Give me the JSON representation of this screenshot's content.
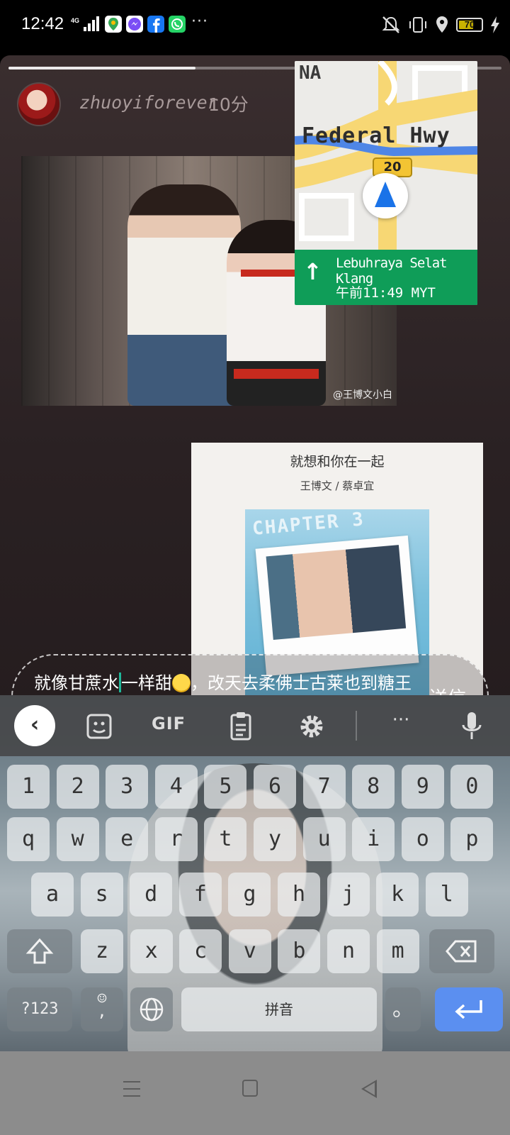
{
  "status_bar": {
    "time": "12:42",
    "network": "4G",
    "more": "···",
    "battery": "70",
    "battery_level": 0.7,
    "app_icons": [
      {
        "name": "maps-icon",
        "color": "#ffffff"
      },
      {
        "name": "messenger-icon",
        "color": "#2f6cf6"
      },
      {
        "name": "facebook-icon",
        "color": "#1877f2"
      },
      {
        "name": "whatsapp-icon",
        "color": "#25d366"
      }
    ]
  },
  "story": {
    "username": "zhuoyiforever",
    "time_ago": "10分",
    "progress": 0.38,
    "photo_watermark": "@王博文小白"
  },
  "map": {
    "area_label": "NA",
    "road_label": "Federal Hwy",
    "route_shield": "20",
    "next_street": "Lebuhraya Selat Klang",
    "eta": "午前11:49 MYT",
    "banner_color": "#0f9d58"
  },
  "song": {
    "title": "就想和你在一起",
    "artist": "王博文 / 蔡卓宜",
    "cover_text": "CHAPTER 3"
  },
  "reply": {
    "text_before_caret": "就像甘蔗水",
    "text_after_caret": "一样甜",
    "text_middle": "，改天去柔佛士古莱也到糖王那儿走走逛逛",
    "send_label": "送信"
  },
  "keyboard": {
    "toolbar": {
      "back": "‹",
      "gif": "GIF",
      "more": "···"
    },
    "rows": [
      [
        "1",
        "2",
        "3",
        "4",
        "5",
        "6",
        "7",
        "8",
        "9",
        "0"
      ],
      [
        "q",
        "w",
        "e",
        "r",
        "t",
        "y",
        "u",
        "i",
        "o",
        "p"
      ],
      [
        "a",
        "s",
        "d",
        "f",
        "g",
        "h",
        "j",
        "k",
        "l"
      ],
      [
        "z",
        "x",
        "c",
        "v",
        "b",
        "n",
        "m"
      ]
    ],
    "symbols_label": "?123",
    "emoji_comma": ",",
    "space_label": "拼音",
    "period_label": "。",
    "accent_color": "#5b8ff0"
  }
}
